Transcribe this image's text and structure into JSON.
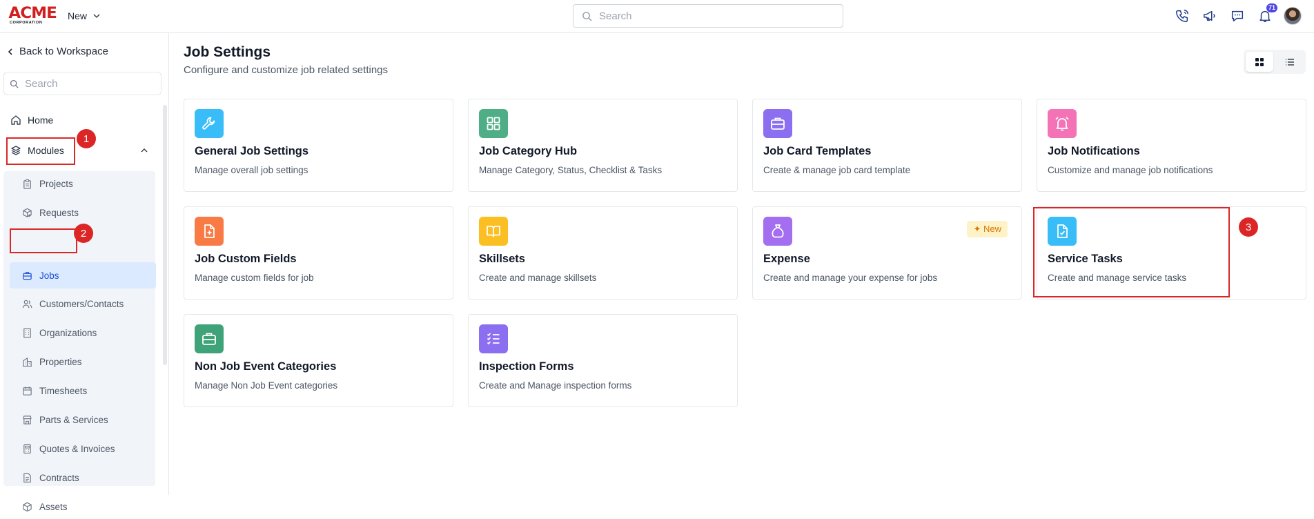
{
  "header": {
    "logo_text": "ACME",
    "logo_subtext": "CORPORATION",
    "new_label": "New",
    "search_placeholder": "Search",
    "notification_count": "71"
  },
  "sidebar": {
    "back_label": "Back to Workspace",
    "search_placeholder": "Search",
    "home_label": "Home",
    "modules_label": "Modules",
    "items": [
      {
        "label": "Projects",
        "icon": "clipboard-icon"
      },
      {
        "label": "Requests",
        "icon": "box-plus-icon"
      },
      {
        "label": "Jobs",
        "icon": "briefcase-icon",
        "active": true
      },
      {
        "label": "Customers/Contacts",
        "icon": "users-icon"
      },
      {
        "label": "Organizations",
        "icon": "building-icon"
      },
      {
        "label": "Properties",
        "icon": "building-icon"
      },
      {
        "label": "Timesheets",
        "icon": "calendar-icon"
      },
      {
        "label": "Parts & Services",
        "icon": "store-icon"
      },
      {
        "label": "Quotes & Invoices",
        "icon": "calculator-icon"
      },
      {
        "label": "Contracts",
        "icon": "document-icon"
      },
      {
        "label": "Assets",
        "icon": "cube-icon"
      }
    ]
  },
  "main": {
    "title": "Job Settings",
    "subtitle": "Configure and customize job related settings",
    "new_badge": "New",
    "cards": [
      {
        "title": "General Job Settings",
        "desc": "Manage overall job settings",
        "icon": "wrench-icon",
        "color": "#38bdf8"
      },
      {
        "title": "Job Category Hub",
        "desc": "Manage Category, Status, Checklist & Tasks",
        "icon": "grid-icon",
        "color": "#4fae86"
      },
      {
        "title": "Job Card Templates",
        "desc": "Create & manage job card template",
        "icon": "briefcase-icon",
        "color": "#8b6ff0"
      },
      {
        "title": "Job Notifications",
        "desc": "Customize and manage job notifications",
        "icon": "alarm-icon",
        "color": "#f472b6"
      },
      {
        "title": "Job Custom Fields",
        "desc": "Manage custom fields for job",
        "icon": "file-plus-icon",
        "color": "#f97a45"
      },
      {
        "title": "Skillsets",
        "desc": "Create and manage skillsets",
        "icon": "book-icon",
        "color": "#fbbf24"
      },
      {
        "title": "Expense",
        "desc": "Create and manage your expense for jobs",
        "icon": "money-bag-icon",
        "color": "#a36ef0"
      },
      {
        "title": "Service Tasks",
        "desc": "Create and manage service tasks",
        "icon": "file-check-icon",
        "color": "#38bdf8"
      },
      {
        "title": "Non Job Event Categories",
        "desc": "Manage Non Job Event categories",
        "icon": "briefcase-icon",
        "color": "#3fa37a"
      },
      {
        "title": "Inspection Forms",
        "desc": "Create and Manage inspection forms",
        "icon": "checklist-icon",
        "color": "#8b6ff0"
      }
    ]
  },
  "annotations": [
    "1",
    "2",
    "3"
  ]
}
